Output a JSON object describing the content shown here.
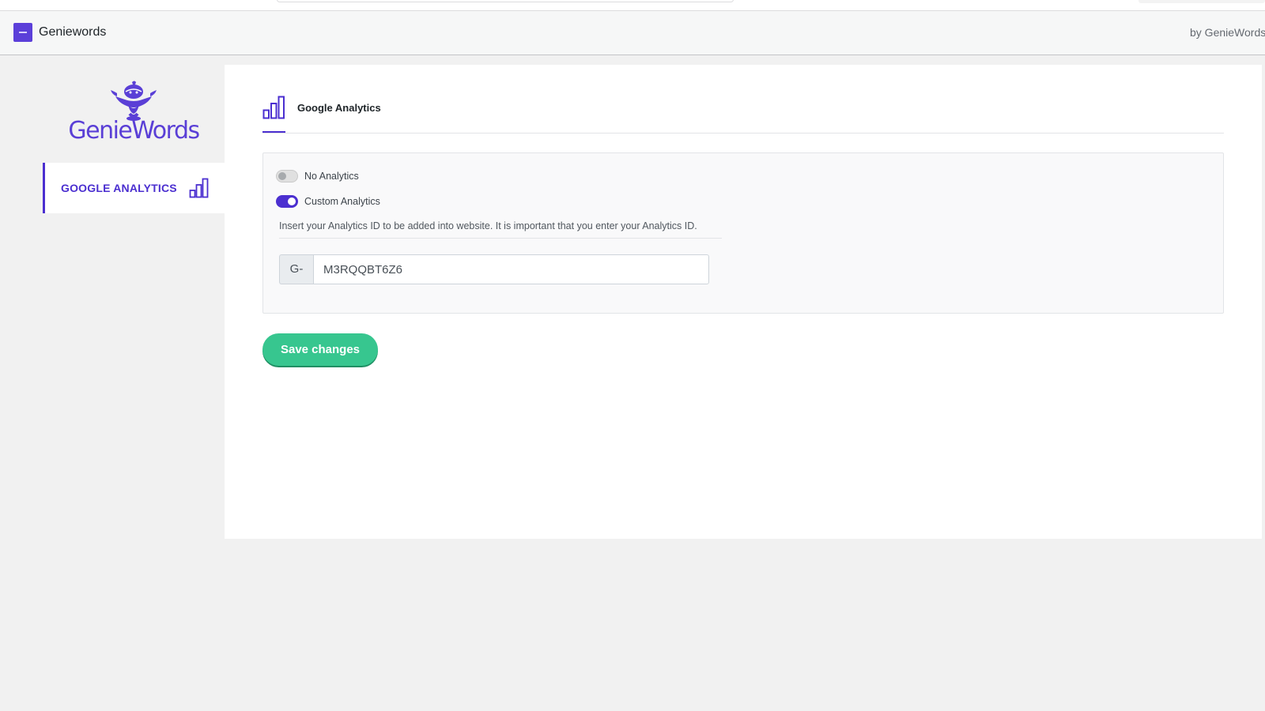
{
  "header": {
    "app_title": "Geniewords",
    "by_text": "by GenieWords"
  },
  "sidebar": {
    "brand_text": "GenieWords",
    "items": [
      {
        "label": "GOOGLE ANALYTICS",
        "icon": "bar-chart-icon",
        "active": true
      }
    ]
  },
  "main": {
    "tab_title": "Google Analytics",
    "tab_icon": "bar-chart-icon",
    "options": [
      {
        "label": "No Analytics",
        "enabled": false
      },
      {
        "label": "Custom Analytics",
        "enabled": true
      }
    ],
    "hint": "Insert your Analytics ID to be added into website. It is important that you enter your Analytics ID.",
    "id_prefix": "G-",
    "id_value": "M3RQQBT6Z6",
    "save_label": "Save changes"
  },
  "colors": {
    "accent": "#4b2fd0",
    "brand": "#5a3fd6",
    "save_button": "#37c68f"
  }
}
